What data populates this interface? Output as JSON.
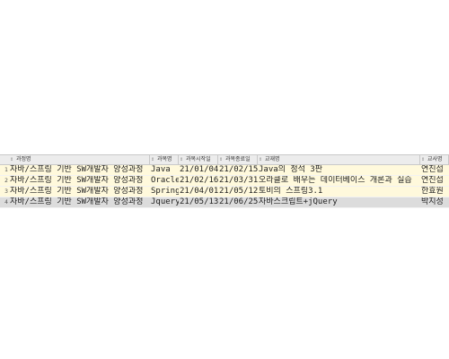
{
  "grid": {
    "columns": [
      "과정명",
      "과목명",
      "과목시작일",
      "과목종료일",
      "교재명",
      "교사명"
    ],
    "rows": [
      {
        "num": "1",
        "course": "자바/스프링 기반 SW개발자 양성과정",
        "subject": "Java",
        "start": "21/01/04",
        "end": "21/02/15",
        "book": "Java의 정석 3판",
        "teacher": "연진섭"
      },
      {
        "num": "2",
        "course": "자바/스프링 기반 SW개발자 양성과정",
        "subject": "Oracle",
        "start": "21/02/16",
        "end": "21/03/31",
        "book": "오라클로 배우는 데이터베이스 개론과 실습",
        "teacher": "연진섭"
      },
      {
        "num": "3",
        "course": "자바/스프링 기반 SW개발자 양성과정",
        "subject": "Spring",
        "start": "21/04/01",
        "end": "21/05/12",
        "book": "토비의 스프링3.1",
        "teacher": "한효원"
      },
      {
        "num": "4",
        "course": "자바/스프링 기반 SW개발자 양성과정",
        "subject": "Jquery",
        "start": "21/05/13",
        "end": "21/06/25",
        "book": "자바스크립트+jQuery",
        "teacher": "박지성"
      }
    ]
  }
}
